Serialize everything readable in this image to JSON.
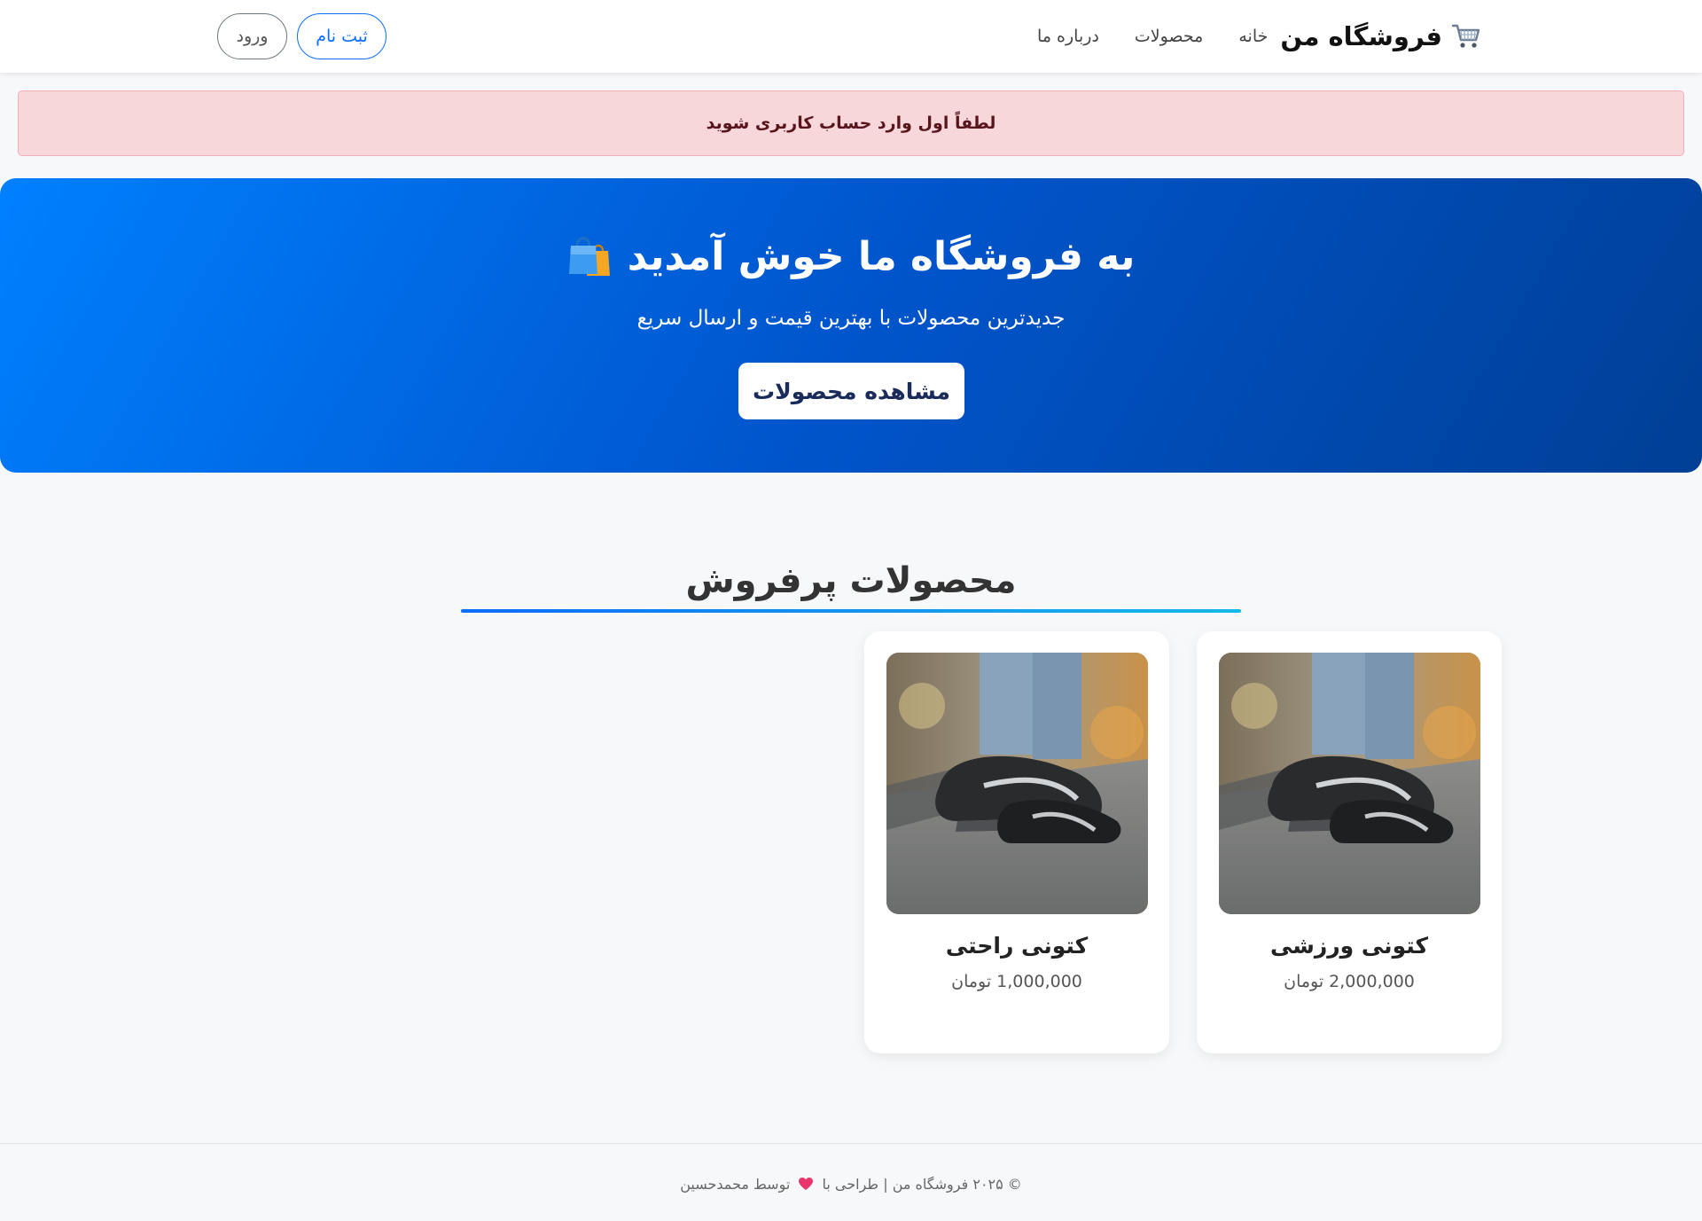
{
  "navbar": {
    "brand": "فروشگاه من",
    "links": [
      "خانه",
      "محصولات",
      "درباره ما"
    ],
    "register_label": "ثبت نام",
    "login_label": "ورود"
  },
  "alert": {
    "message": "لطفاً اول وارد حساب کاربری شوید"
  },
  "hero": {
    "title": "به فروشگاه ما خوش آمدید",
    "subtitle": "جدیدترین محصولات با بهترین قیمت و ارسال سریع",
    "button_label": "مشاهده محصولات"
  },
  "section": {
    "title": "محصولات پرفروش"
  },
  "products": [
    {
      "name": "کتونی ورزشی",
      "price": "2,000,000 تومان",
      "image": "black-sneaker-photo"
    },
    {
      "name": "کتونی راحتی",
      "price": "1,000,000 تومان",
      "image": "black-sneaker-photo"
    }
  ],
  "footer": {
    "text_before_heart": "© ۲۰۲۵ فروشگاه من | طراحی با",
    "text_after_heart": "توسط محمدحسین"
  },
  "colors": {
    "primary": "#0d6efd",
    "alert_bg": "#f8d7da",
    "hero_start": "#0080ff",
    "hero_end": "#003f96"
  },
  "icons": {
    "brand": "shopping-cart-icon",
    "hero": "shopping-bags-icon",
    "footer": "heart-icon"
  }
}
